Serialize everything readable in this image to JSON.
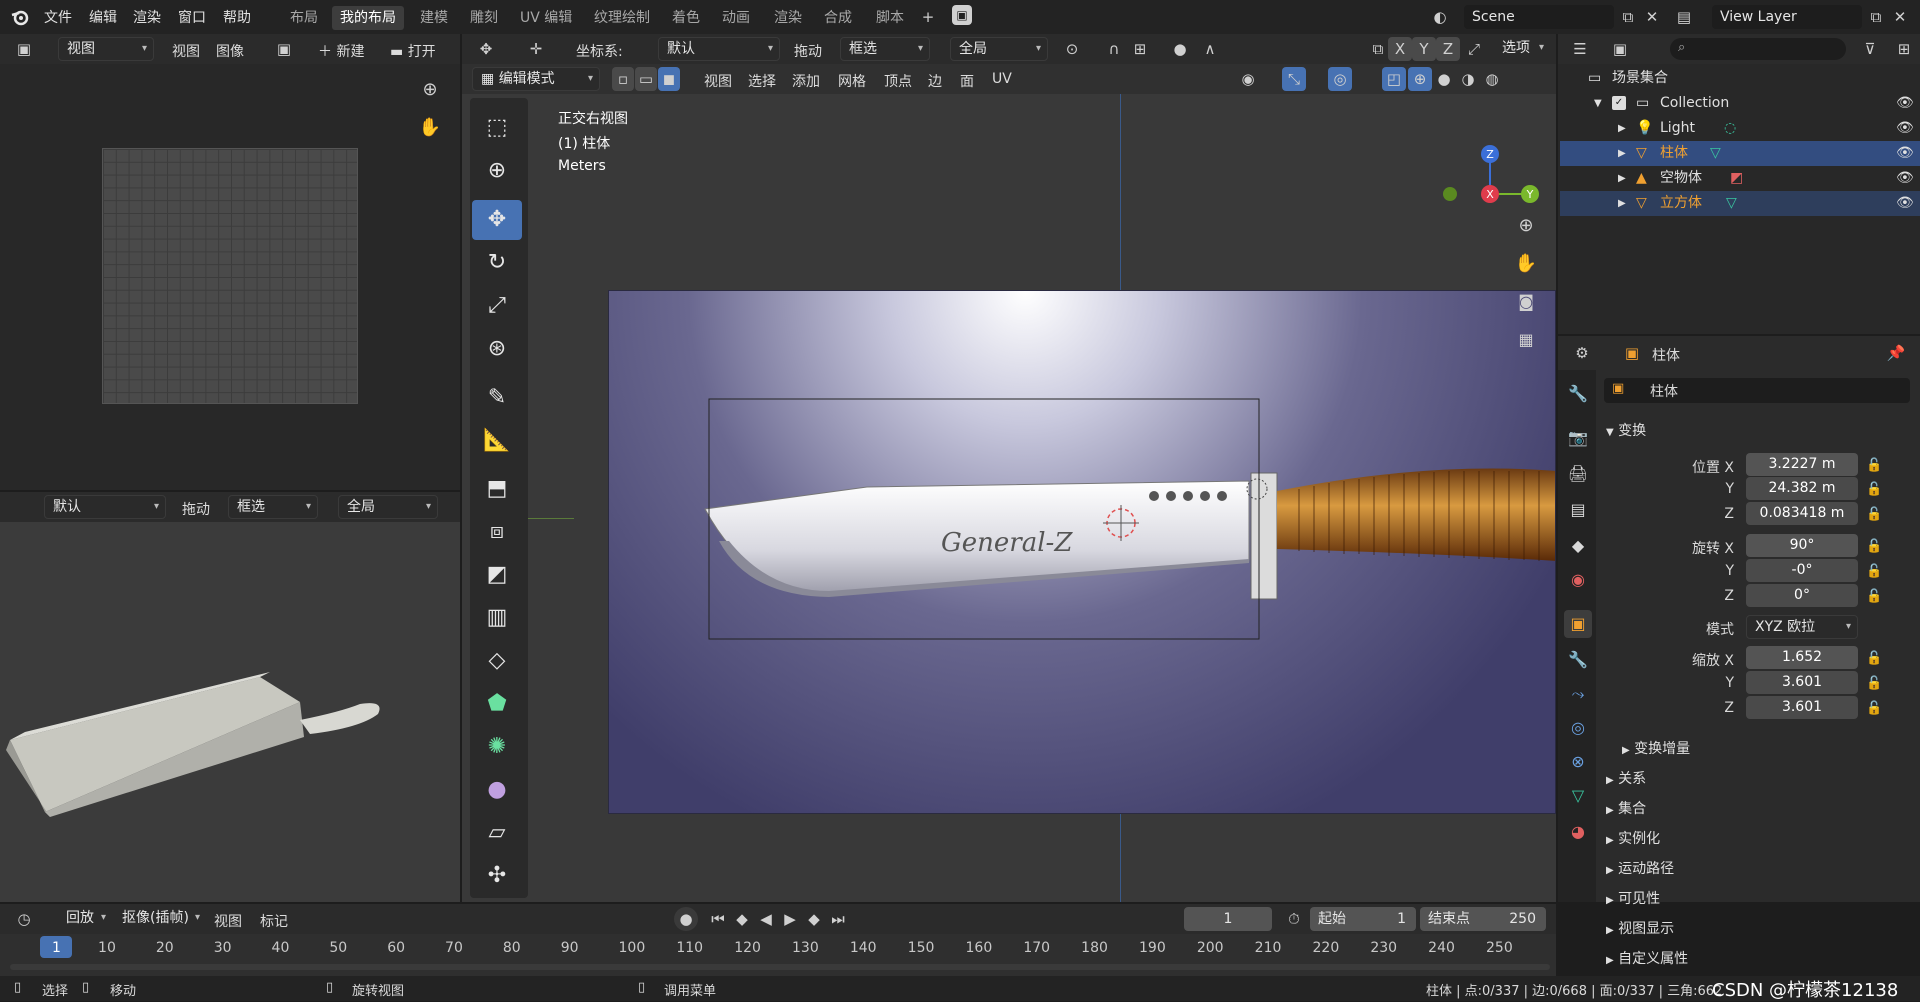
{
  "menu": [
    "文件",
    "编辑",
    "渲染",
    "窗口",
    "帮助"
  ],
  "workspace_tabs": [
    {
      "label": "布局",
      "active": false
    },
    {
      "label": "我的布局",
      "active": true
    },
    {
      "label": "建模",
      "active": false
    },
    {
      "label": "雕刻",
      "active": false
    },
    {
      "label": "UV 编辑",
      "active": false
    },
    {
      "label": "纹理绘制",
      "active": false
    },
    {
      "label": "着色",
      "active": false
    },
    {
      "label": "动画",
      "active": false
    },
    {
      "label": "渲染",
      "active": false
    },
    {
      "label": "合成",
      "active": false
    },
    {
      "label": "脚本",
      "active": false
    }
  ],
  "scene": {
    "name": "Scene"
  },
  "view_layer": {
    "name": "View Layer"
  },
  "image_editor": {
    "view": "视图",
    "view2": "视图",
    "image": "图像",
    "new": "新建",
    "open": "打开"
  },
  "left_header2": {
    "pivot": "默认",
    "drag": "拖动",
    "select": "框选",
    "orientation": "全局"
  },
  "viewport_header": {
    "coord_label": "坐标系:",
    "coord_value": "默认",
    "drag_label": "拖动",
    "select_value": "框选",
    "orientation_value": "全局",
    "options": "选项",
    "mode": "编辑模式",
    "view": "视图",
    "select": "选择",
    "add": "添加",
    "mesh": "网格",
    "vertex": "顶点",
    "edge": "边",
    "face": "面",
    "uv": "UV",
    "axis_x": "X",
    "axis_y": "Y",
    "axis_z": "Z"
  },
  "viewport_overlay": {
    "view_name": "正交右视图",
    "object": "(1) 柱体",
    "units": "Meters"
  },
  "knife_text": "General-Z",
  "gizmo": {
    "x": "X",
    "y": "Y",
    "z": "Z"
  },
  "outliner": {
    "root": "场景集合",
    "items": [
      {
        "label": "Collection",
        "depth": 1,
        "selected": false,
        "color": "#e0e0e0"
      },
      {
        "label": "Light",
        "depth": 2,
        "selected": false,
        "color": "#e0e0e0"
      },
      {
        "label": "柱体",
        "depth": 2,
        "selected": true,
        "color": "#f0a030"
      },
      {
        "label": "空物体",
        "depth": 2,
        "selected": false,
        "color": "#e0e0e0"
      },
      {
        "label": "立方体",
        "depth": 2,
        "selected": true,
        "color": "#f0a030"
      }
    ]
  },
  "properties": {
    "object_name": "柱体",
    "object_field": "柱体",
    "transform_title": "变换",
    "location": {
      "label": "位置 X",
      "x": "3.2227 m",
      "y": "24.382 m",
      "z": "0.083418 m"
    },
    "rotation": {
      "label": "旋转 X",
      "x": "90°",
      "y": "-0°",
      "z": "0°"
    },
    "mode_label": "模式",
    "mode_value": "XYZ 欧拉",
    "scale": {
      "label": "缩放 X",
      "x": "1.652",
      "y": "3.601",
      "z": "3.601"
    },
    "y_label": "Y",
    "z_label": "Z",
    "delta": "变换增量",
    "sections": [
      "关系",
      "集合",
      "实例化",
      "运动路径",
      "可见性",
      "视图显示",
      "自定义属性"
    ]
  },
  "timeline": {
    "playback": "回放",
    "keying": "抠像(插帧)",
    "view": "视图",
    "marker": "标记",
    "current_frame": "1",
    "start_label": "起始",
    "start": "1",
    "end_label": "结束点",
    "end": "250",
    "ticks": [
      "1",
      "10",
      "20",
      "30",
      "40",
      "50",
      "60",
      "70",
      "80",
      "90",
      "100",
      "110",
      "120",
      "130",
      "140",
      "150",
      "160",
      "170",
      "180",
      "190",
      "200",
      "210",
      "220",
      "230",
      "240",
      "250"
    ]
  },
  "statusbar": {
    "select": "选择",
    "move": "移动",
    "rotate": "旋转视图",
    "menu": "调用菜单",
    "stats": "柱体 | 点:0/337 | 边:0/668 | 面:0/337 | 三角:662",
    "watermark": "CSDN @柠檬茶12138"
  }
}
